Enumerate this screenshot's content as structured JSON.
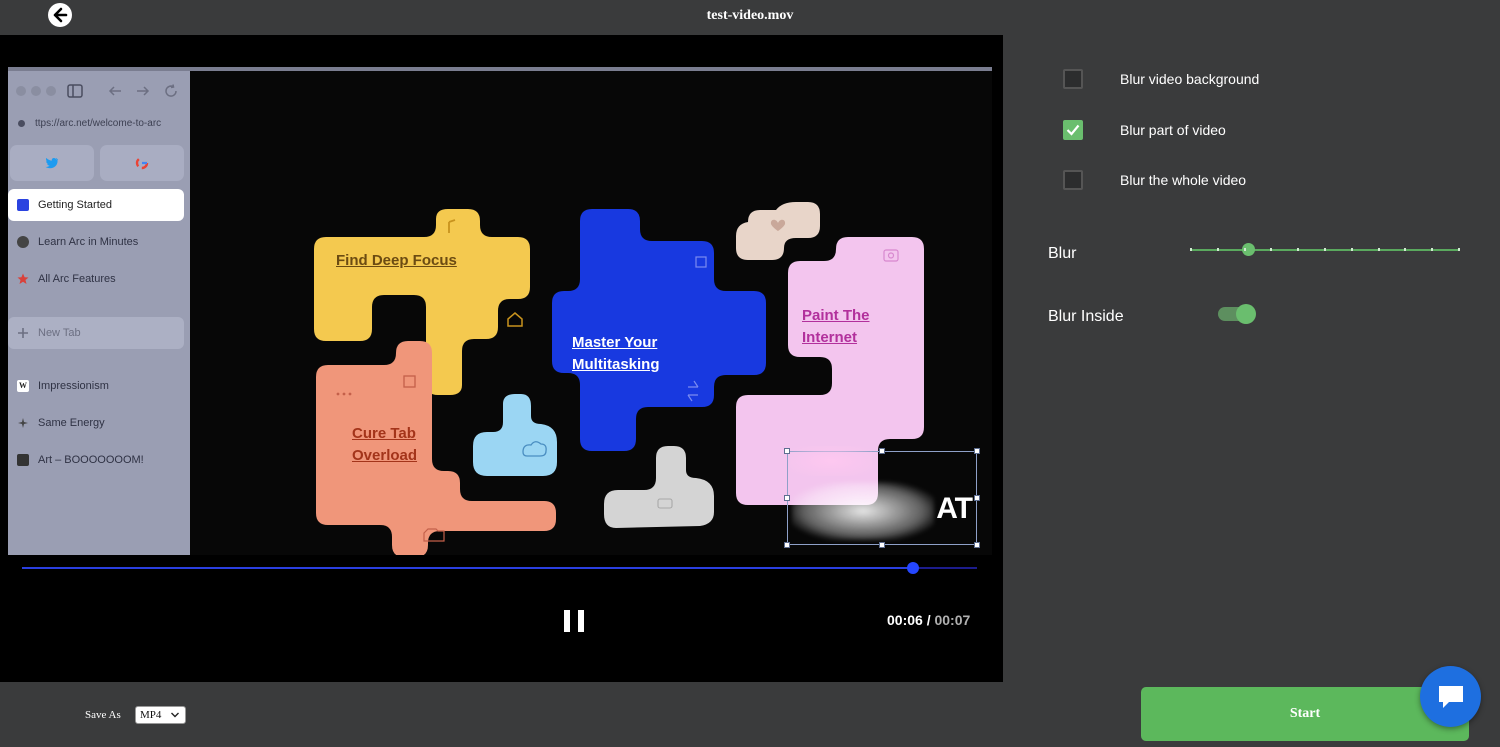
{
  "header": {
    "title": "test-video.mov",
    "back_icon": "arrow-left-icon"
  },
  "video": {
    "arc_sidebar": {
      "url": "ttps://arc.net/welcome-to-arc",
      "pinned": [
        {
          "icon": "twitter-icon"
        },
        {
          "icon": "google-icon"
        }
      ],
      "items": [
        {
          "label": "Getting Started",
          "icon": "square-icon",
          "color": "#2a43e0"
        },
        {
          "label": "Learn Arc in Minutes",
          "icon": "person-icon",
          "color": "#444"
        },
        {
          "label": "All Arc Features",
          "icon": "star-icon",
          "color": "#d9413a"
        },
        {
          "label": "New Tab",
          "icon": "plus-icon",
          "color": "#6c6f82"
        },
        {
          "label": "Impressionism",
          "icon": "wikipedia-icon",
          "color": "#ffffff"
        },
        {
          "label": "Same Energy",
          "icon": "sparkle-icon",
          "color": "#444"
        },
        {
          "label": "Art – BOOOOOOOM!",
          "icon": "film-icon",
          "color": "#333"
        }
      ]
    },
    "tiles": {
      "yellow": {
        "line1": "Find Deep Focus",
        "color": "#f4c94f",
        "text_color": "#6b4b12"
      },
      "blue": {
        "line1": "Master Your",
        "line2": "Multitasking",
        "color": "#1839e0",
        "text_color": "#ffffff"
      },
      "pink": {
        "line1": "Paint The",
        "line2": "Internet",
        "color": "#f3c5ee",
        "text_color": "#b2309c"
      },
      "orange": {
        "line1": "Cure Tab",
        "line2": "Overload",
        "color": "#f0967a",
        "text_color": "#a3341a"
      }
    },
    "overlay_text": "AT"
  },
  "playback": {
    "current": "00:06",
    "separator": "/",
    "duration": "00:07",
    "progress": 0.933
  },
  "options": {
    "blur_background": {
      "label": "Blur video background",
      "checked": false
    },
    "blur_part": {
      "label": "Blur part of video",
      "checked": true
    },
    "blur_whole": {
      "label": "Blur the whole video",
      "checked": false
    }
  },
  "blur": {
    "label": "Blur",
    "value": 0.215,
    "ticks": 11
  },
  "blur_inside": {
    "label": "Blur Inside",
    "on": true
  },
  "footer": {
    "save_as": "Save As",
    "format": "MP4",
    "start": "Start"
  },
  "colors": {
    "accent": "#5cb85c",
    "progress": "#2547ff",
    "chat": "#1e6fe0"
  }
}
